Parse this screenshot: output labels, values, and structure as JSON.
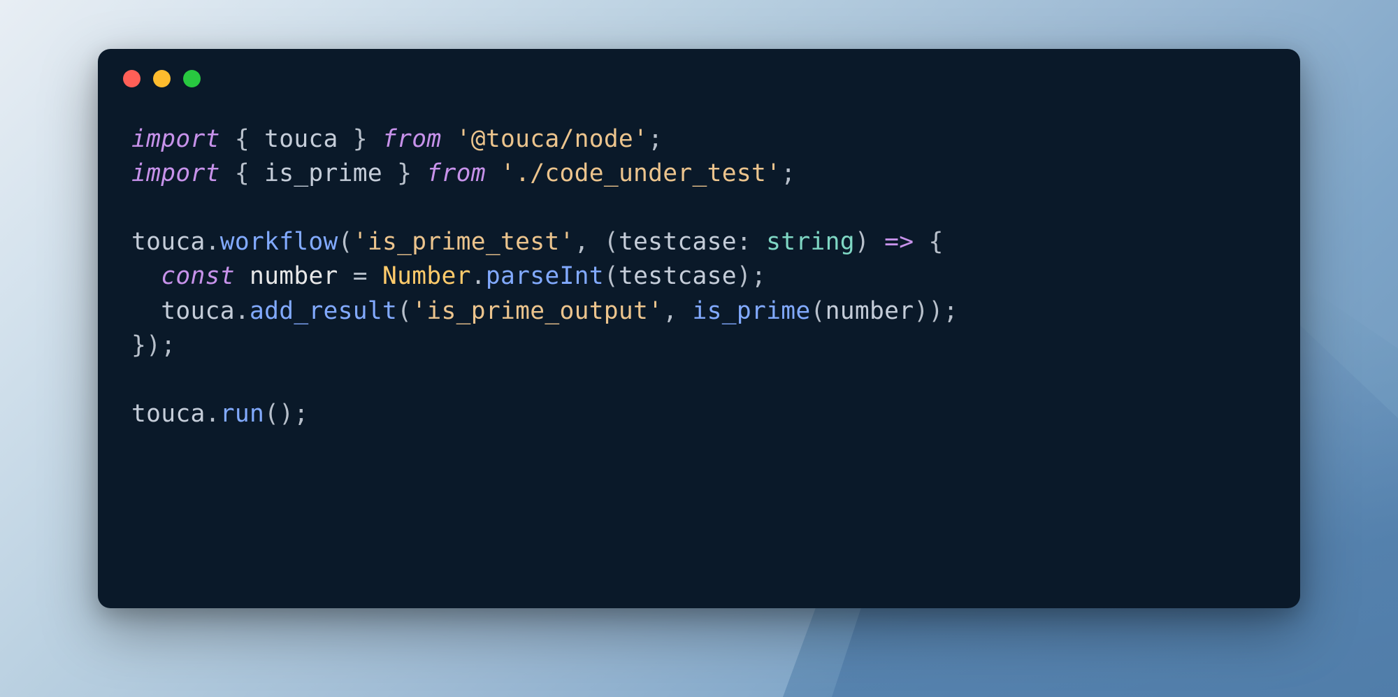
{
  "code": {
    "line1": {
      "import": "import",
      "brace_open": " { ",
      "touca": "touca",
      "brace_close": " } ",
      "from": "from",
      "space": " ",
      "str": "'@touca/node'",
      "semi": ";"
    },
    "line2": {
      "import": "import",
      "brace_open": " { ",
      "is_prime": "is_prime",
      "brace_close": " } ",
      "from": "from",
      "space": " ",
      "str": "'./code_under_test'",
      "semi": ";"
    },
    "line4": {
      "touca": "touca",
      "dot": ".",
      "workflow": "workflow",
      "paren_open": "(",
      "str": "'is_prime_test'",
      "comma": ", (",
      "testcase": "testcase",
      "colon": ": ",
      "string_type": "string",
      "paren_close": ") ",
      "arrow": "=>",
      "brace": " {"
    },
    "line5": {
      "indent": "  ",
      "const": "const",
      "space": " ",
      "number_var": "number",
      "eq": " = ",
      "Number": "Number",
      "dot": ".",
      "parseInt": "parseInt",
      "paren_open": "(",
      "testcase": "testcase",
      "paren_close_semi": ");"
    },
    "line6": {
      "indent": "  ",
      "touca": "touca",
      "dot": ".",
      "add_result": "add_result",
      "paren_open": "(",
      "str": "'is_prime_output'",
      "comma": ", ",
      "is_prime": "is_prime",
      "paren_open2": "(",
      "number_var": "number",
      "paren_close": "));"
    },
    "line7": {
      "close": "});"
    },
    "line9": {
      "touca": "touca",
      "dot": ".",
      "run": "run",
      "parens": "();"
    }
  }
}
